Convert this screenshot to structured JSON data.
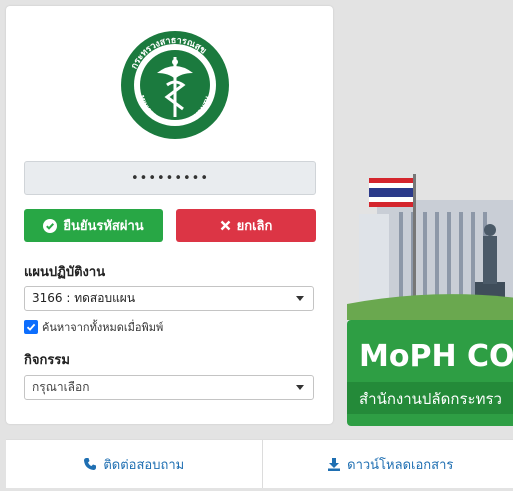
{
  "logo": {
    "text_top": "กระทรวงสาธารณสุข",
    "text_bottom": "MINISTRY OF PUBLIC HEALTH",
    "color": "#1b7a3e"
  },
  "password": {
    "value": "•••••••••"
  },
  "buttons": {
    "confirm": {
      "label": "ยืนยันรหัสผ่าน",
      "icon": "check-circle-icon",
      "color": "#28a745"
    },
    "cancel": {
      "label": "ยกเลิก",
      "icon": "times-icon",
      "color": "#dc3545"
    }
  },
  "department": {
    "label": "แผนปฏิบัติงาน",
    "selected": "3166 : ทดสอบแผน",
    "search_all": {
      "label": "ค้นหาจากทั้งหมดเมื่อพิมพ์",
      "checked": true
    }
  },
  "activity": {
    "label": "กิจกรรม",
    "placeholder": "กรุณาเลือก"
  },
  "banner": {
    "title": "MoPH CO",
    "subtitle": "สำนักงานปลัดกระทรว",
    "accent": "#2e9e44"
  },
  "footer": {
    "contact": {
      "label": "ติดต่อสอบถาม",
      "icon": "phone-icon"
    },
    "download": {
      "label": "ดาวน์โหลดเอกสาร",
      "icon": "download-icon"
    }
  }
}
